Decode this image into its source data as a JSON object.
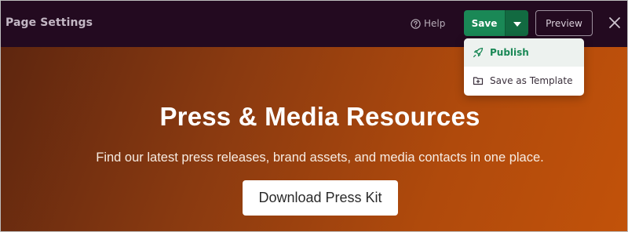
{
  "header": {
    "title": "Page Settings",
    "help_label": "Help",
    "save_label": "Save",
    "preview_label": "Preview"
  },
  "dropdown": {
    "items": [
      {
        "label": "Publish",
        "icon": "rocket-icon",
        "active": true
      },
      {
        "label": "Save as Template",
        "icon": "folder-plus-icon",
        "active": false
      }
    ]
  },
  "hero": {
    "title": "Press & Media Resources",
    "subtitle": "Find our latest press releases, brand assets, and media contacts in one place.",
    "button_label": "Download Press Kit"
  },
  "colors": {
    "topbar": "#230a20",
    "accent_green": "#1a8856",
    "hero_gradient_start": "#5e260f",
    "hero_gradient_end": "#c2520a"
  }
}
